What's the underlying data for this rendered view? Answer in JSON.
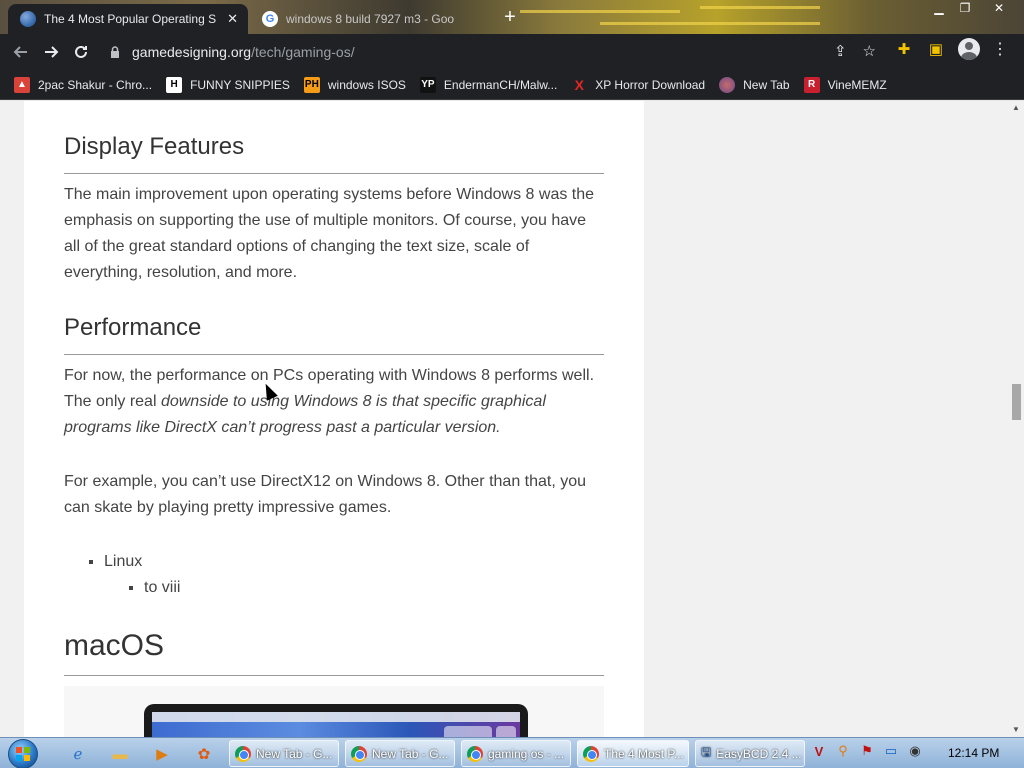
{
  "browser": {
    "tabs": [
      {
        "title": "The 4 Most Popular Operating S",
        "active": true
      },
      {
        "title": "windows 8 build 7927 m3 - Goo",
        "active": false
      }
    ],
    "url_host": "gamedesigning.org",
    "url_path": "/tech/gaming-os/",
    "bookmarks": [
      {
        "label": "2pac Shakur - Chro...",
        "icon": "2pac-icon"
      },
      {
        "label": "FUNNY SNIPPIES",
        "icon": "H"
      },
      {
        "label": "windows ISOS",
        "icon": "PH"
      },
      {
        "label": "EndermanCH/Malw...",
        "icon": "YP"
      },
      {
        "label": "XP Horror Download",
        "icon": "X"
      },
      {
        "label": "New Tab",
        "icon": "newtab-icon"
      },
      {
        "label": "VineMEMZ",
        "icon": "R"
      }
    ]
  },
  "article": {
    "display_heading": "Display Features",
    "display_para": "The main improvement upon operating systems before Windows 8 was the emphasis on supporting the use of multiple monitors. Of course, you have all of the great standard options of changing the text size, scale of everything, resolution, and more.",
    "perf_heading": "Performance",
    "perf_para_a": "For now, the performance on PCs operating with Windows 8 performs well. The only real ",
    "perf_para_em": "downside to using Windows 8 is that specific graphical programs like DirectX can’t progress past a particular version.",
    "perf_para2": "For example, you can’t use DirectX12 on Windows 8. Other than that, you can skate by playing pretty impressive games.",
    "list_item": "Linux",
    "sublist_item": "to viii",
    "macos_heading": "macOS"
  },
  "taskbar": {
    "buttons": [
      {
        "label": "New Tab - G...",
        "active": false
      },
      {
        "label": "New Tab - G...",
        "active": false
      },
      {
        "label": "gaming os - ...",
        "active": false
      },
      {
        "label": "The 4 Most P...",
        "active": true
      },
      {
        "label": "EasyBCD 2.4 ...",
        "active": false
      }
    ],
    "clock": "12:14 PM"
  },
  "colors": {
    "chrome_dark": "#202124",
    "taskbar_blue": "#8fb2d8",
    "heading_text": "#333333"
  }
}
